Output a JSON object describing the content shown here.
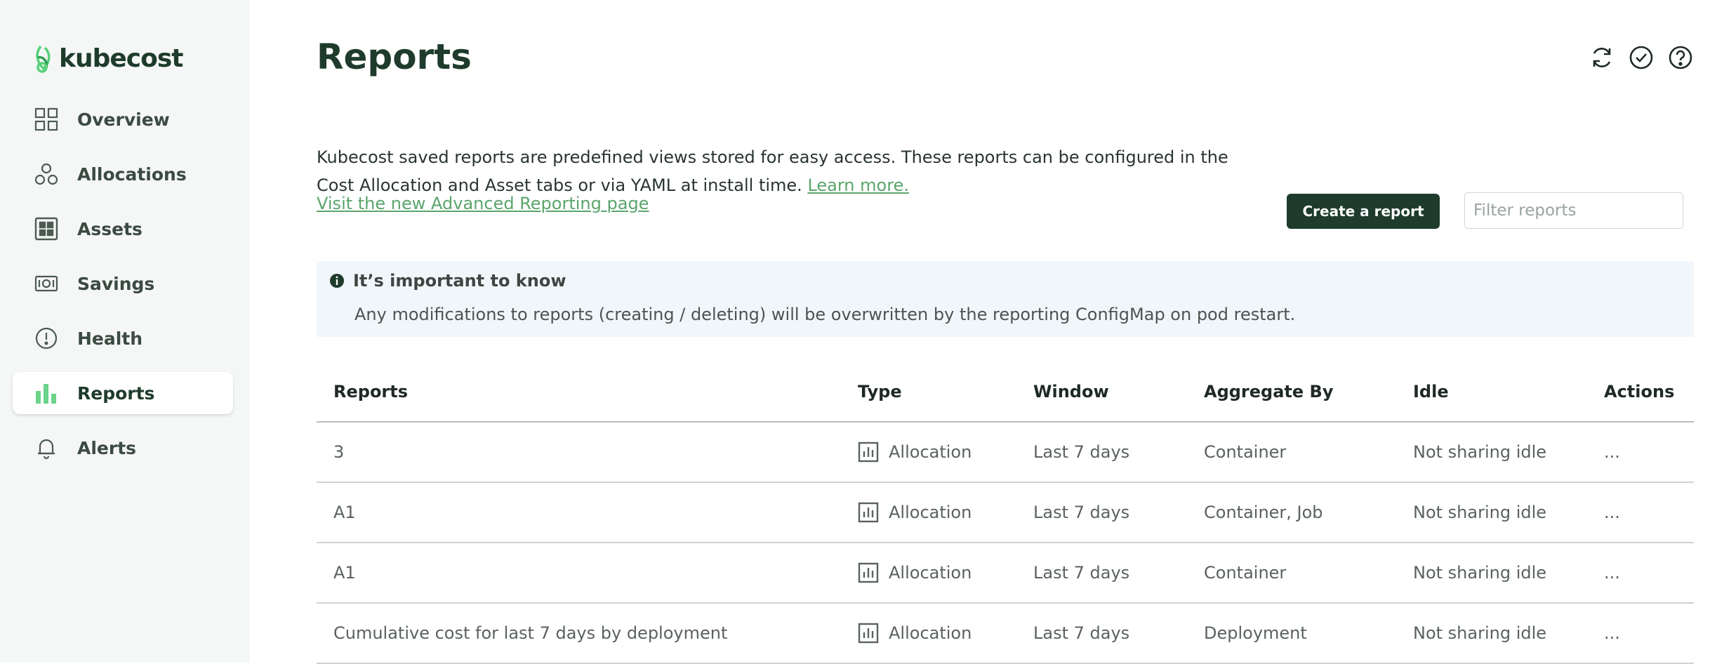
{
  "brand": {
    "name": "kubecost",
    "accent": "#1e3b2c",
    "link": "#5ba56c"
  },
  "sidebar": {
    "items": [
      {
        "label": "Overview",
        "icon": "grid-icon",
        "active": false
      },
      {
        "label": "Allocations",
        "icon": "circles-icon",
        "active": false
      },
      {
        "label": "Assets",
        "icon": "assets-icon",
        "active": false
      },
      {
        "label": "Savings",
        "icon": "money-icon",
        "active": false
      },
      {
        "label": "Health",
        "icon": "alert-circle-icon",
        "active": false
      },
      {
        "label": "Reports",
        "icon": "bar-chart-icon",
        "active": true
      },
      {
        "label": "Alerts",
        "icon": "bell-icon",
        "active": false
      }
    ]
  },
  "header": {
    "title": "Reports",
    "icons": [
      "refresh-icon",
      "check-circle-icon",
      "help-icon"
    ]
  },
  "intro": {
    "text": "Kubecost saved reports are predefined views stored for easy access. These reports can be configured in the Cost Allocation and Asset tabs or via YAML at install time.",
    "learn_more": "Learn more.",
    "advanced_link": "Visit the new Advanced Reporting page"
  },
  "actions": {
    "create_label": "Create a report",
    "filter_placeholder": "Filter reports"
  },
  "notice": {
    "title": "It’s important to know",
    "body": "Any modifications to reports (creating / deleting) will be overwritten by the reporting ConfigMap on pod restart."
  },
  "table": {
    "headers": [
      "Reports",
      "Type",
      "Window",
      "Aggregate By",
      "Idle",
      "Actions"
    ],
    "rows": [
      {
        "name": "3",
        "type": "Allocation",
        "window": "Last 7 days",
        "aggregate": "Container",
        "idle": "Not sharing idle",
        "actions": "..."
      },
      {
        "name": "A1",
        "type": "Allocation",
        "window": "Last 7 days",
        "aggregate": "Container, Job",
        "idle": "Not sharing idle",
        "actions": "..."
      },
      {
        "name": "A1",
        "type": "Allocation",
        "window": "Last 7 days",
        "aggregate": "Container",
        "idle": "Not sharing idle",
        "actions": "..."
      },
      {
        "name": "Cumulative cost for last 7 days by deployment",
        "type": "Allocation",
        "window": "Last 7 days",
        "aggregate": "Deployment",
        "idle": "Not sharing idle",
        "actions": "..."
      }
    ]
  }
}
